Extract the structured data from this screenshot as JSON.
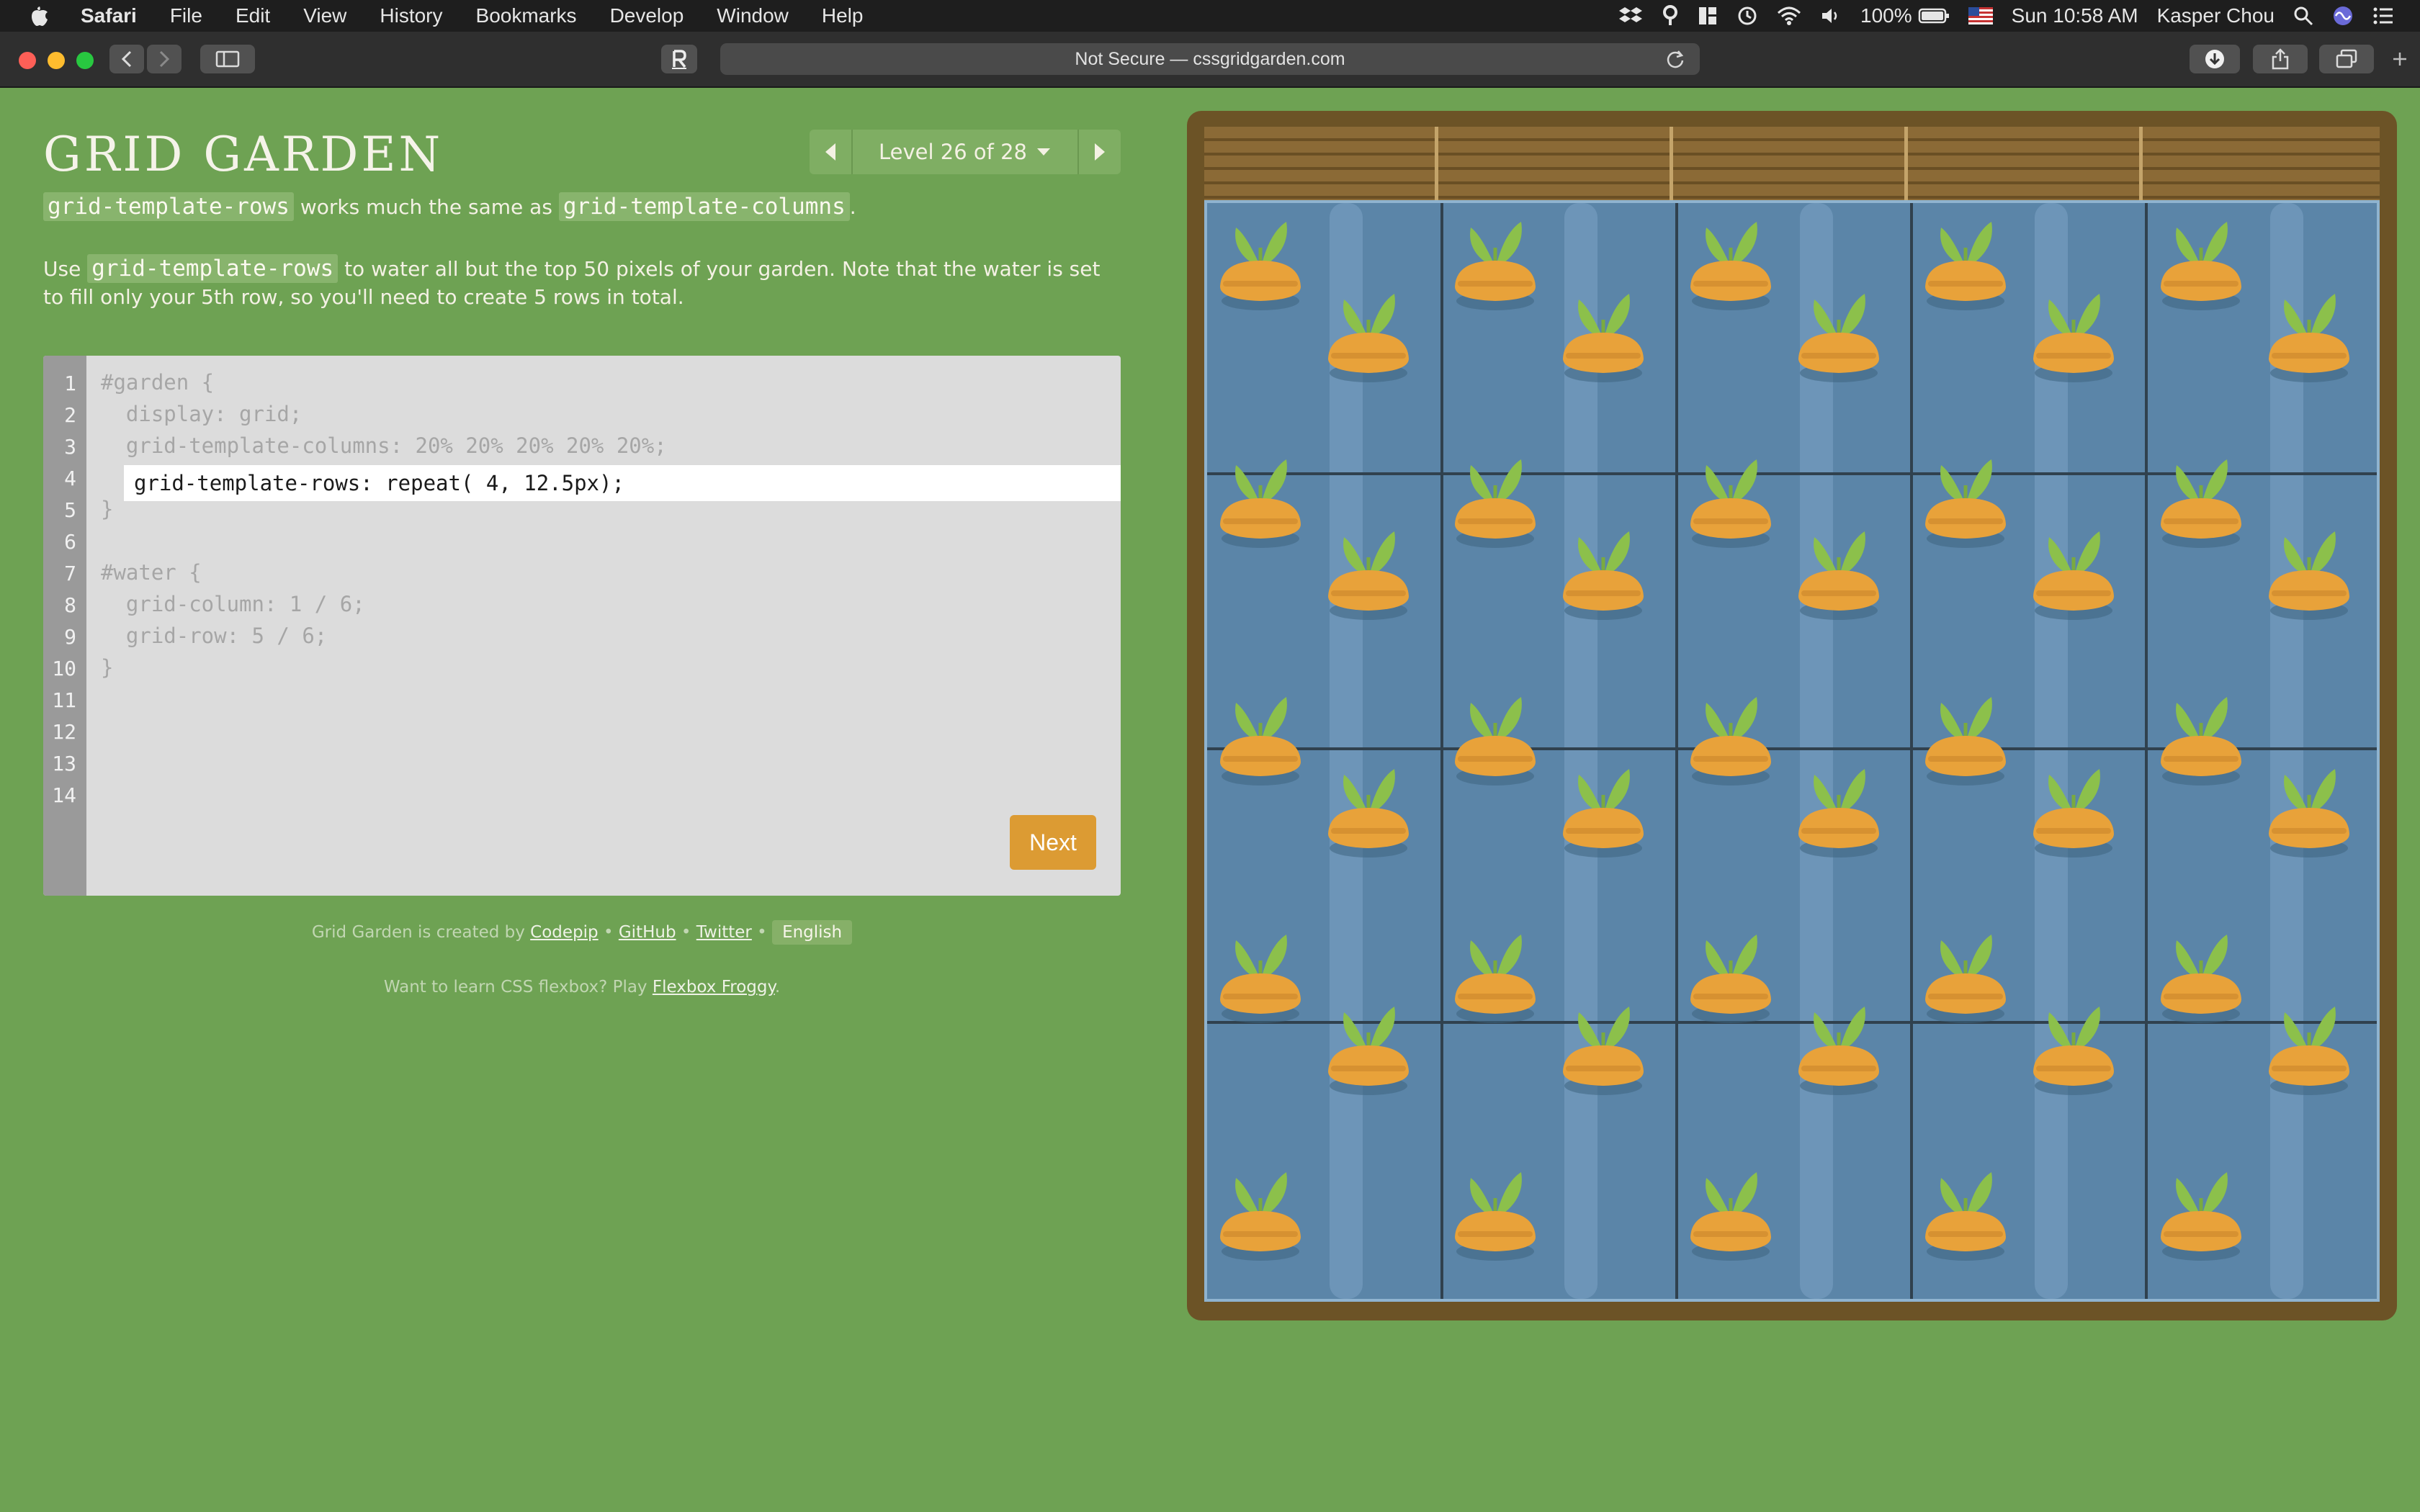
{
  "menubar": {
    "app_name": "Safari",
    "menus": [
      "File",
      "Edit",
      "View",
      "History",
      "Bookmarks",
      "Develop",
      "Window",
      "Help"
    ],
    "battery": "100%",
    "clock": "Sun 10:58 AM",
    "user": "Kasper Chou"
  },
  "toolbar": {
    "address": "Not Secure — cssgridgarden.com"
  },
  "game": {
    "title": "GRID GARDEN",
    "level_label": "Level 26 of 28",
    "intro": {
      "code1": "grid-template-rows",
      "text1": " works much the same as ",
      "code2": "grid-template-columns",
      "text2": "."
    },
    "task": {
      "prefix": "Use ",
      "code": "grid-template-rows",
      "text": " to water all but the top 50 pixels of your garden. Note that the water is set to fill only your 5th row, so you'll need to create 5 rows in total."
    },
    "editor": {
      "line_numbers": [
        "1",
        "2",
        "3",
        "4",
        "5",
        "6",
        "7",
        "8",
        "9",
        "10",
        "11",
        "12",
        "13",
        "14"
      ],
      "lines": {
        "l1": "#garden {",
        "l2": "  display: grid;",
        "l3": "  grid-template-columns: 20% 20% 20% 20% 20%;",
        "l5": "}",
        "l7": "#water {",
        "l8": "  grid-column: 1 / 6;",
        "l9": "  grid-row: 5 / 6;",
        "l10": "}"
      },
      "input_value": "grid-template-rows: repeat( 4, 12.5px);"
    },
    "next_label": "Next",
    "footer": {
      "created_by": "Grid Garden is created by ",
      "codepip": "Codepip",
      "github": "GitHub",
      "twitter": "Twitter",
      "sep": " • ",
      "language": "English",
      "learn": "Want to learn CSS flexbox? Play ",
      "froggy": "Flexbox Froggy",
      "period": "."
    }
  },
  "colors": {
    "background": "#6ea253",
    "water": "#5b85a8",
    "carrot": "#e8a23a",
    "leaf": "#8cc04b",
    "next_button": "#dc9b33"
  }
}
